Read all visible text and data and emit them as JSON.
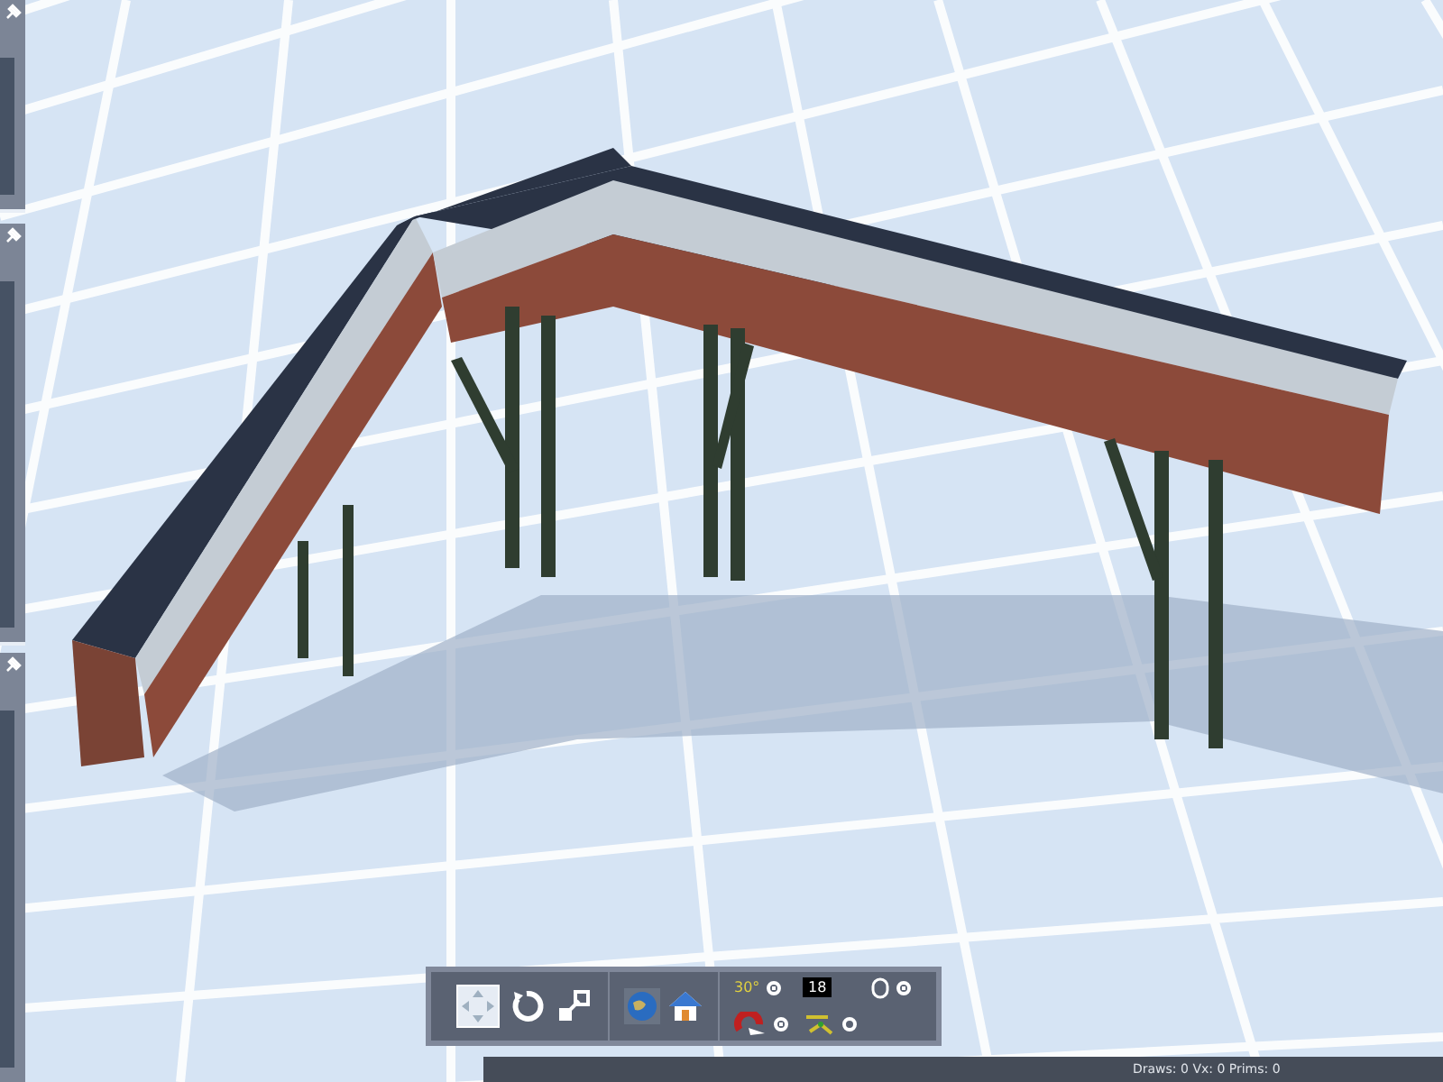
{
  "side_panels": [
    {
      "pinned": true
    },
    {
      "pinned": true
    },
    {
      "pinned": true
    }
  ],
  "toolbar": {
    "angle_label": "30°",
    "grid_value": "18",
    "toggles": [
      {
        "on": true
      },
      {
        "on": true
      },
      {
        "on": true
      },
      {
        "on": false
      }
    ]
  },
  "status_bar": {
    "text": "Draws: 0 Vx: 0 Prims: 0"
  }
}
